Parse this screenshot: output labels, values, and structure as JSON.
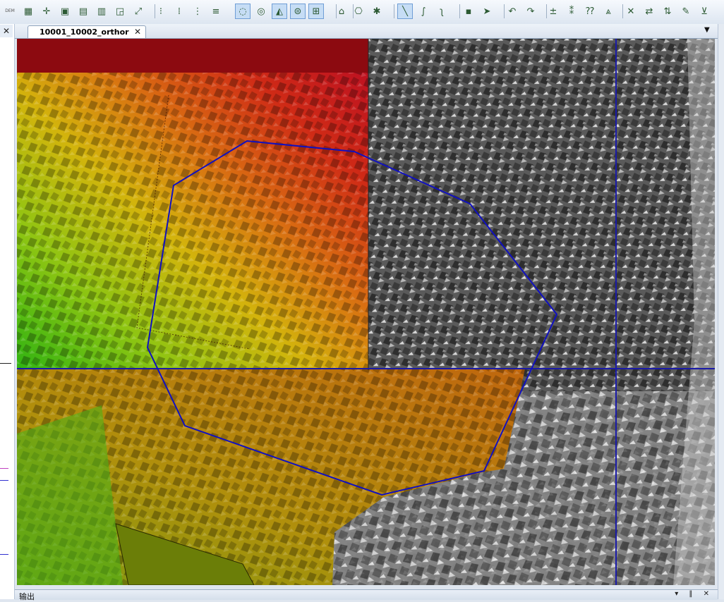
{
  "toolbar": {
    "buttons": [
      {
        "name": "dem-dem",
        "glyph": "DEM"
      },
      {
        "name": "image-1",
        "glyph": "▦"
      },
      {
        "name": "point-insert",
        "glyph": "✛"
      },
      {
        "name": "image-2",
        "glyph": "▣"
      },
      {
        "name": "image-3",
        "glyph": "▤"
      },
      {
        "name": "image-4",
        "glyph": "▥"
      },
      {
        "name": "image-5",
        "glyph": "◲"
      },
      {
        "name": "fullscreen",
        "glyph": "⤢"
      },
      {
        "name": "grid-1",
        "glyph": "⁝"
      },
      {
        "name": "grid-2",
        "glyph": "⁞"
      },
      {
        "name": "grid-3",
        "glyph": "⋮"
      },
      {
        "name": "grid-4",
        "glyph": "≡"
      },
      {
        "name": "circle-select",
        "glyph": "◌"
      },
      {
        "name": "target",
        "glyph": "◎"
      },
      {
        "name": "cone",
        "glyph": "◭"
      },
      {
        "name": "layer-ellipse",
        "glyph": "⊜"
      },
      {
        "name": "layer-stack",
        "glyph": "⊞"
      },
      {
        "name": "tag",
        "glyph": "⌂"
      },
      {
        "name": "view-3d",
        "glyph": "⎔"
      },
      {
        "name": "marker",
        "glyph": "✱"
      },
      {
        "name": "line-draw",
        "glyph": "╲"
      },
      {
        "name": "curve-draw",
        "glyph": "∫"
      },
      {
        "name": "curve-draw-2",
        "glyph": "ʅ"
      },
      {
        "name": "save",
        "glyph": "▪"
      },
      {
        "name": "select-add",
        "glyph": "➤"
      },
      {
        "name": "undo",
        "glyph": "↶"
      },
      {
        "name": "redo",
        "glyph": "↷"
      },
      {
        "name": "add-point",
        "glyph": "±"
      },
      {
        "name": "insert-point",
        "glyph": "⁑"
      },
      {
        "name": "question-point",
        "glyph": "⁇"
      },
      {
        "name": "elevation",
        "glyph": "⩓"
      },
      {
        "name": "delete-point",
        "glyph": "✕"
      },
      {
        "name": "swap-horizontal",
        "glyph": "⇄"
      },
      {
        "name": "swap-vertical",
        "glyph": "⇅"
      },
      {
        "name": "edit-doc",
        "glyph": "✎"
      },
      {
        "name": "filter",
        "glyph": "⊻"
      }
    ]
  },
  "left_panel": {
    "close_glyph": "✕"
  },
  "tab": {
    "label": "10001_10002_orthor",
    "close_glyph": "✕"
  },
  "tab_dropdown_glyph": "▼",
  "bottom_panel": {
    "title": "输出",
    "controls": "▾ ‖ ✕"
  },
  "colors": {
    "boundary_line": "#1010c0",
    "crosshair": "#1a1aa8",
    "red_band": "#8c0a10",
    "flat_patch": "#6b7e08"
  }
}
